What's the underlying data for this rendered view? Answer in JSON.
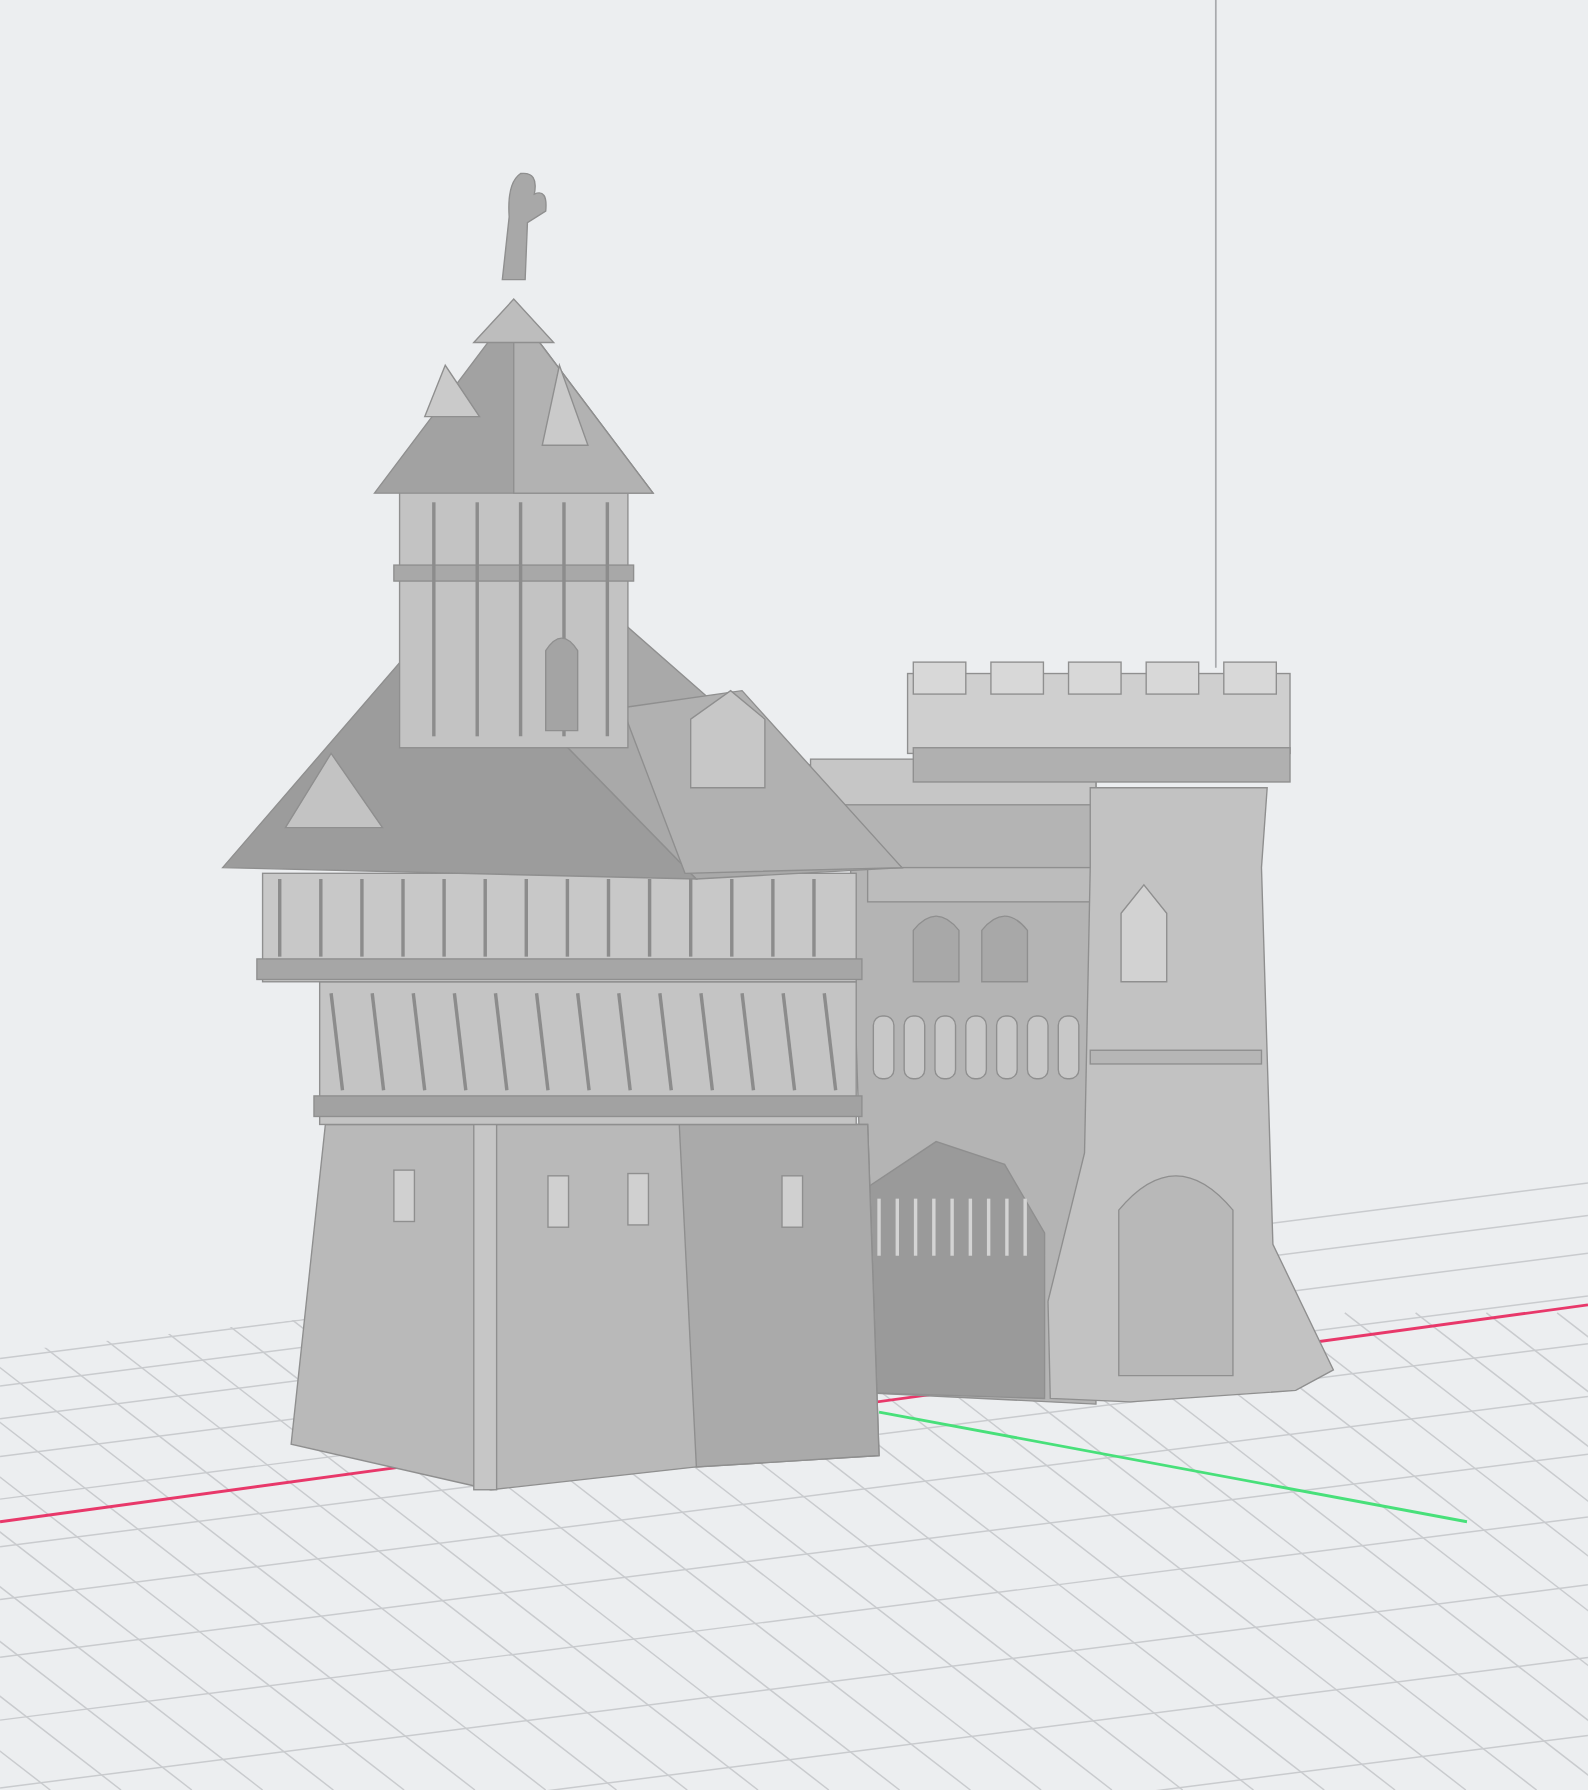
{
  "viewport": {
    "axes": [
      {
        "kind": "x",
        "color": "#e8386a"
      },
      {
        "kind": "y",
        "color": "#48e07a"
      }
    ]
  }
}
